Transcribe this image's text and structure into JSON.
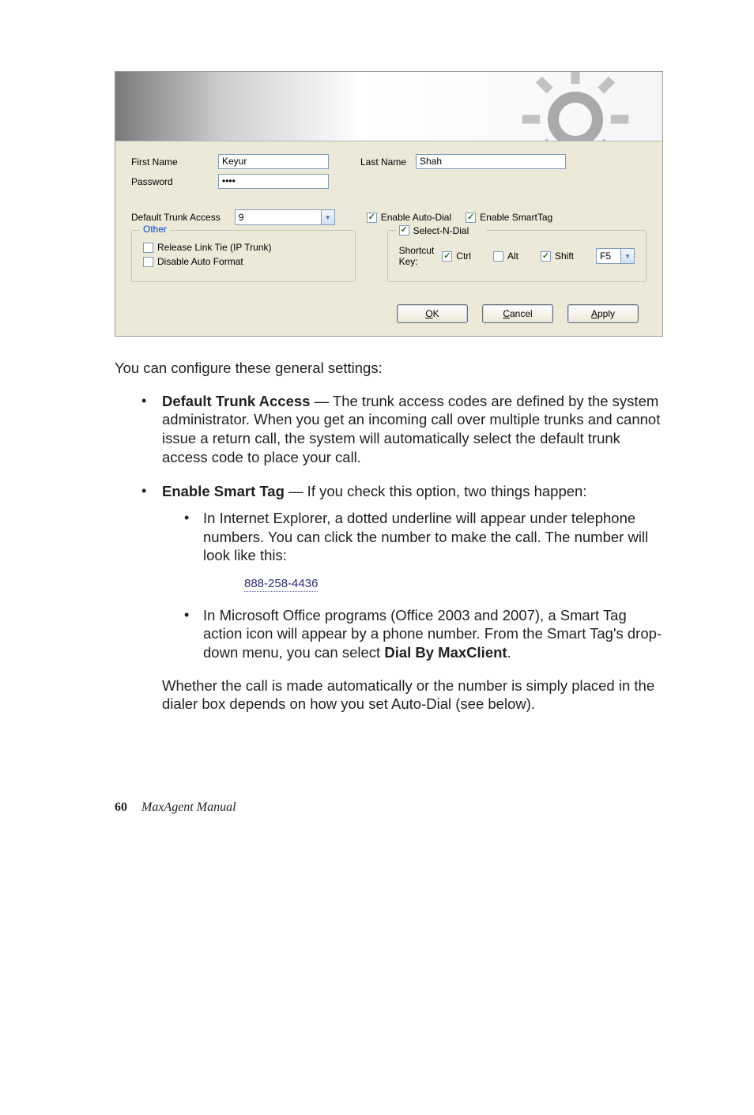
{
  "dialog": {
    "close": "×",
    "firstNameLabel": "First Name",
    "firstNameValue": "Keyur",
    "lastNameLabel": "Last Name",
    "lastNameValue": "Shah",
    "passwordLabel": "Password",
    "passwordValue": "••••",
    "defaultTrunkLabel": "Default Trunk Access",
    "defaultTrunkValue": "9",
    "enableAutoDialLabel": "Enable Auto-Dial",
    "enableSmartTagLabel": "Enable SmartTag",
    "fieldset1Legend": "Other",
    "releaseLinkLabel": "Release Link Tie (IP Trunk)",
    "disableAutoFormatLabel": "Disable Auto Format",
    "fieldset2Legend": "Select-N-Dial",
    "shortcutKeyLabel": "Shortcut Key:",
    "ctrlLabel": "Ctrl",
    "altLabel": "Alt",
    "shiftLabel": "Shift",
    "fkeyValue": "F5",
    "okLabel": "OK",
    "cancelLabel": "Cancel",
    "applyLabel": "Apply",
    "checkMark": "✓",
    "dropdownGlyph": "▾"
  },
  "doc": {
    "intro": "You can configure these general settings:",
    "b1_title": "Default Trunk Access",
    "b1_text": " — The trunk access codes are defined by the system administrator. When you get an incoming call over multiple trunks and cannot issue a return call, the system will automatically select the default trunk access code to place your call.",
    "b2_title": "Enable Smart Tag",
    "b2_text": " — If you check this option, two things happen:",
    "b2a": "In Internet Explorer, a dotted underline will appear under telephone numbers. You can click the number to make the call. The number will look like this:",
    "phone_sample": "888-258-4436",
    "b2b_pre": "In Microsoft Office programs (Office 2003 and 2007), a Smart Tag action icon will appear by a phone number. From the Smart Tag's drop-down menu, you can select ",
    "b2b_bold": "Dial By MaxClient",
    "b2b_post": ".",
    "after": "Whether the call is made automatically or the number is simply placed in the dialer box depends on how you set Auto-Dial (see below).",
    "pageNum": "60",
    "manualTitle": "MaxAgent Manual"
  }
}
